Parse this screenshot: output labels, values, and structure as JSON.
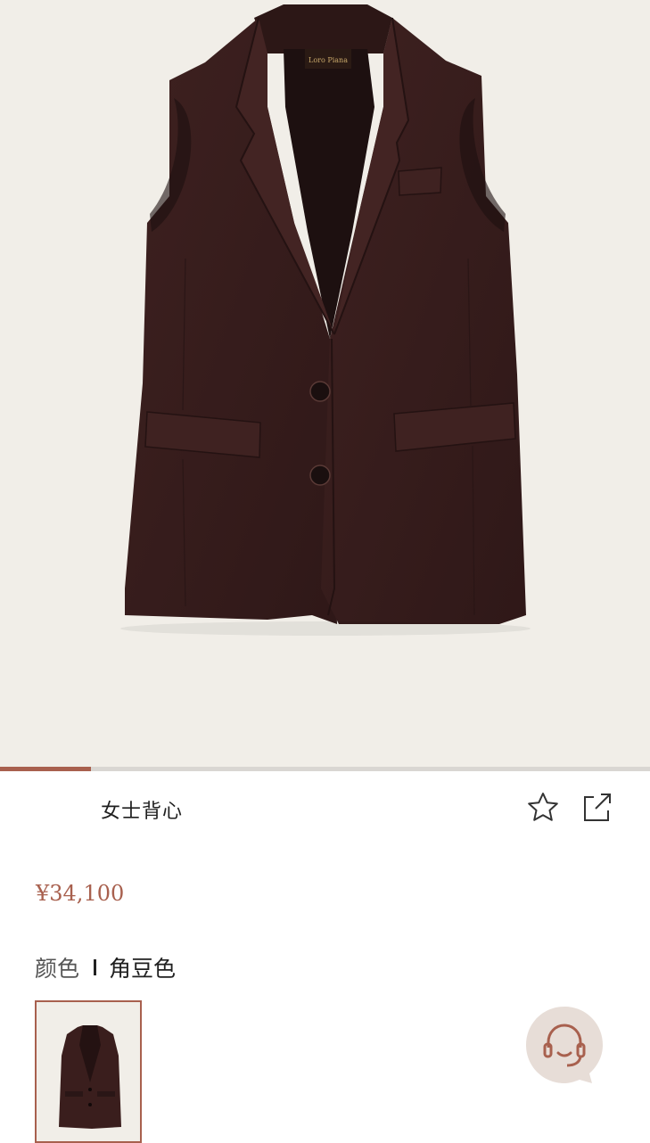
{
  "product": {
    "title": "女士背心",
    "price": "¥34,100",
    "image_alt": "brown sleeveless vest",
    "gallery_progress": 0.14
  },
  "color": {
    "label": "颜色",
    "value": "角豆色"
  },
  "icons": {
    "favorite": "star-icon",
    "share": "share-icon",
    "support": "headset-icon"
  },
  "colors": {
    "accent": "#a8604e",
    "hero_bg": "#f1eee8",
    "garment": "#3b1f1e",
    "support_bg": "#e7ddd7"
  }
}
